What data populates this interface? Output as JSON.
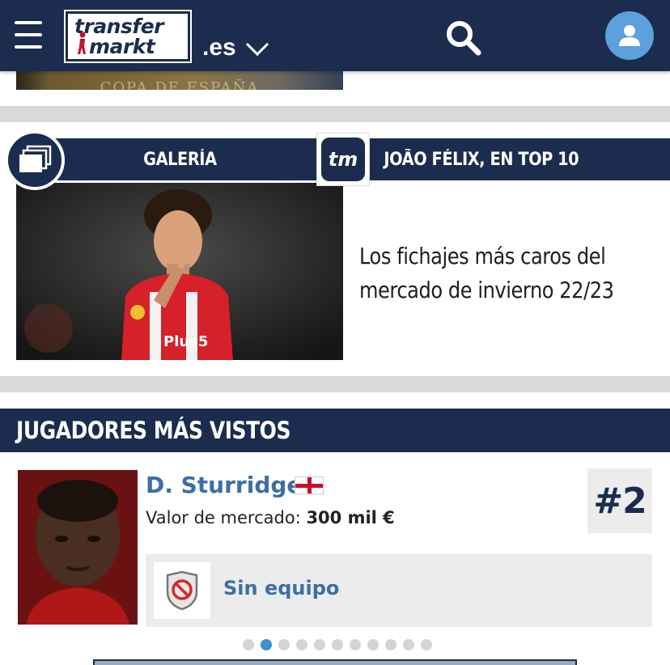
{
  "header": {
    "logo_line1": "transfer",
    "logo_line2": "markt",
    "domain": ".es",
    "menu_icon": "hamburger-menu-icon",
    "search_icon": "search-icon",
    "account_icon": "user-icon",
    "colors": {
      "navy": "#1b2c4e",
      "accent_blue": "#5ca0dc"
    }
  },
  "top_card": {
    "image_text": "COPA DE ESPAÑA"
  },
  "gallery": {
    "category": "GALERÍA",
    "badge": "tm",
    "tag": "JOÃO FÉLIX, EN TOP 10",
    "headline": "Los fichajes más caros del mercado de invierno 22/23",
    "photo_shirt_text": "Plus5"
  },
  "most_viewed": {
    "title": "JUGADORES MÁS VISTOS",
    "player": {
      "name": "D. Sturridge",
      "nationality_flag": "england-flag-icon",
      "market_value_label": "Valor de mercado:",
      "market_value": "300 mil €",
      "rank": "#2",
      "club": "Sin equipo",
      "club_icon": "no-club-crest-icon"
    },
    "pagination": {
      "total": 11,
      "active_index": 1
    }
  }
}
